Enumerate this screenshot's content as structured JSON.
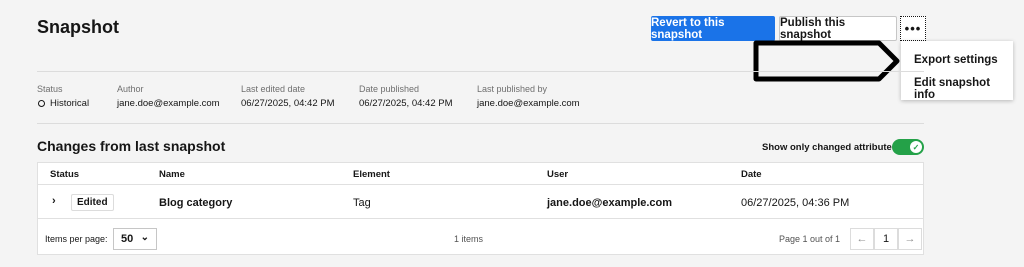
{
  "header": {
    "title": "Snapshot",
    "revert_label": "Revert to this snapshot",
    "publish_label": "Publish this snapshot",
    "more_label": "•••"
  },
  "overflow_menu": {
    "items": [
      {
        "label": "Export settings"
      },
      {
        "label": "Edit snapshot info"
      }
    ]
  },
  "meta": {
    "status_label": "Status",
    "status_value": "Historical",
    "author_label": "Author",
    "author_value": "jane.doe@example.com",
    "last_edited_label": "Last edited date",
    "last_edited_value": "06/27/2025, 04:42 PM",
    "date_published_label": "Date published",
    "date_published_value": "06/27/2025, 04:42 PM",
    "last_published_by_label": "Last published by",
    "last_published_by_value": "jane.doe@example.com"
  },
  "changes": {
    "title": "Changes from last snapshot",
    "toggle_label": "Show only changed attributes",
    "toggle_checked_glyph": "✓",
    "columns": [
      "Status",
      "Name",
      "Element",
      "User",
      "Date"
    ],
    "rows": [
      {
        "status": "Edited",
        "name": "Blog category",
        "element": "Tag",
        "user": "jane.doe@example.com",
        "date": "06/27/2025, 04:36 PM"
      }
    ],
    "footer": {
      "items_per_page_label": "Items per page:",
      "items_per_page_value": "50",
      "items_count": "1 items",
      "page_info": "Page 1 out of 1",
      "page_number": "1"
    }
  },
  "colors": {
    "primary": "#1a73e8",
    "toggle_on": "#24a148"
  }
}
